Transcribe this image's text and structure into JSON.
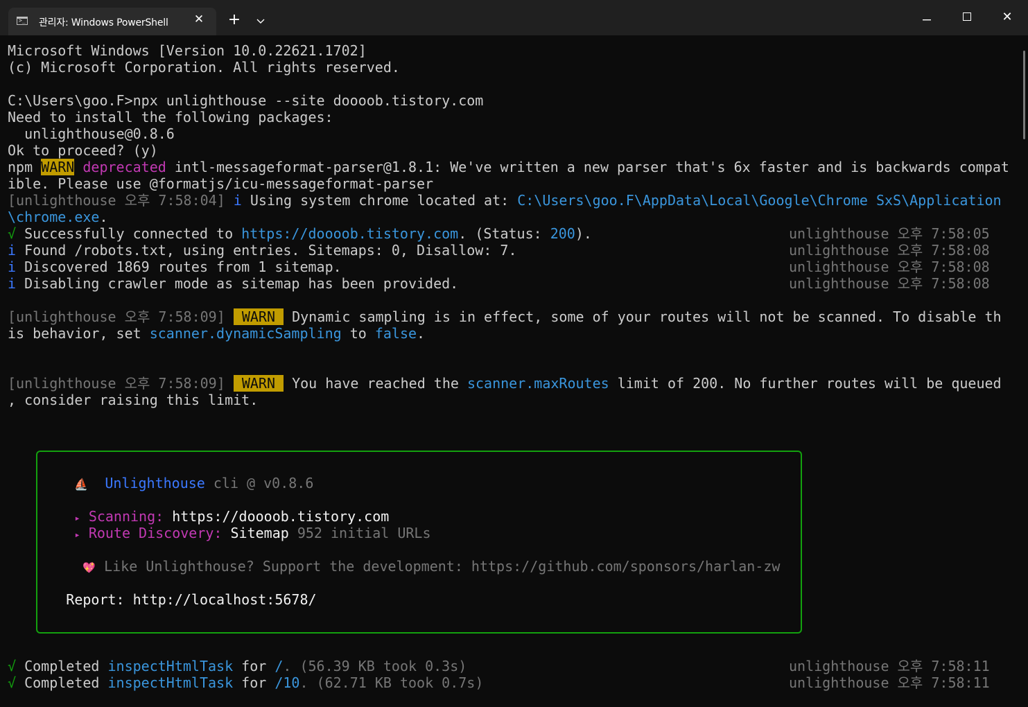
{
  "window": {
    "tab_title": "관리자: Windows PowerShell",
    "tab_icon": "terminal-icon",
    "tab_close": "✕",
    "new_tab": "+",
    "dropdown": "⌄",
    "minimize": "—",
    "close": "✕"
  },
  "colors": {
    "background": "#0c0c0c",
    "text": "#cccccc",
    "green": "#13a10e",
    "blue": "#3b78ff",
    "link": "#3a96dd",
    "magenta": "#c239b3",
    "warn": "#c19c00",
    "gray": "#767676"
  },
  "terminal": {
    "l1": "Microsoft Windows [Version 10.0.22621.1702]",
    "l2": "(c) Microsoft Corporation. All rights reserved.",
    "l4": "C:\\Users\\goo.F>npx unlighthouse --site doooob.tistory.com",
    "l5": "Need to install the following packages:",
    "l6": "  unlighthouse@0.8.6",
    "l7": "Ok to proceed? (y)",
    "l8_npm": "npm ",
    "l8_warn": "WARN",
    "l8_dep": "deprecated",
    "l8_rest": " intl-messageformat-parser@1.8.1: We've written a new parser that's 6x faster and is backwards compat",
    "l9": "ible. Please use @formatjs/icu-messageformat-parser",
    "l10_tag": "[unlighthouse 오후 7:58:04]",
    "l10_i": "i",
    "l10_text": " Using system chrome located at: ",
    "l10_path": "C:\\Users\\goo.F\\AppData\\Local\\Google\\Chrome SxS\\Application",
    "l11": "\\chrome.exe",
    "l11_dot": ".",
    "l12_check": "√",
    "l12_text": " Successfully connected to ",
    "l12_url": "https://doooob.tistory.com",
    "l12_status": ". (Status: ",
    "l12_code": "200",
    "l12_end": ").",
    "l12_right": "unlighthouse 오후 7:58:05",
    "l13_i": "i",
    "l13_text": " Found /robots.txt, using entries. Sitemaps: 0, Disallow: 7.",
    "l13_right": "unlighthouse 오후 7:58:08",
    "l14_i": "i",
    "l14_text": " Discovered 1869 routes from 1 sitemap.",
    "l14_right": "unlighthouse 오후 7:58:08",
    "l15_i": "i",
    "l15_text": " Disabling crawler mode as sitemap has been provided.",
    "l15_right": "unlighthouse 오후 7:58:08",
    "l17_tag": "[unlighthouse 오후 7:58:09]",
    "l17_warn": " WARN ",
    "l17_text": " Dynamic sampling is in effect, some of your routes will not be scanned. To disable th",
    "l18_a": "is behavior, set ",
    "l18_code": "scanner.dynamicSampling",
    "l18_b": " to ",
    "l18_false": "false",
    "l18_c": ".",
    "l21_tag": "[unlighthouse 오후 7:58:09]",
    "l21_warn": " WARN ",
    "l21_a": " You have reached the ",
    "l21_code": "scanner.maxRoutes",
    "l21_b": " limit of 200. No further routes will be queued",
    "l22": ", consider raising this limit.",
    "b1_icon": "⛵",
    "b1_name": "Unlighthouse",
    "b1_ver": " cli @ v0.8.6",
    "b3_arrow": "▸",
    "b3_label": "Scanning:",
    "b3_value": " https://doooob.tistory.com",
    "b4_arrow": "▸",
    "b4_label": "Route Discovery:",
    "b4_value": " Sitemap",
    "b4_extra": " 952 initial URLs",
    "b6_icon": "💖",
    "b6_text": " Like Unlighthouse? Support the development: https://github.com/sponsors/harlan-zw",
    "b8_label": "Report: ",
    "b8_url": "http://localhost:5678/",
    "c1_check": "√",
    "c1_a": " Completed ",
    "c1_task": "inspectHtmlTask",
    "c1_b": " for ",
    "c1_path": "/",
    "c1_c": ". (56.39 KB took 0.3s)",
    "c1_right": "unlighthouse 오후 7:58:11",
    "c2_check": "√",
    "c2_a": " Completed ",
    "c2_task": "inspectHtmlTask",
    "c2_b": " for ",
    "c2_path": "/10",
    "c2_c": ". (62.71 KB took 0.7s)",
    "c2_right": "unlighthouse 오후 7:58:11"
  }
}
